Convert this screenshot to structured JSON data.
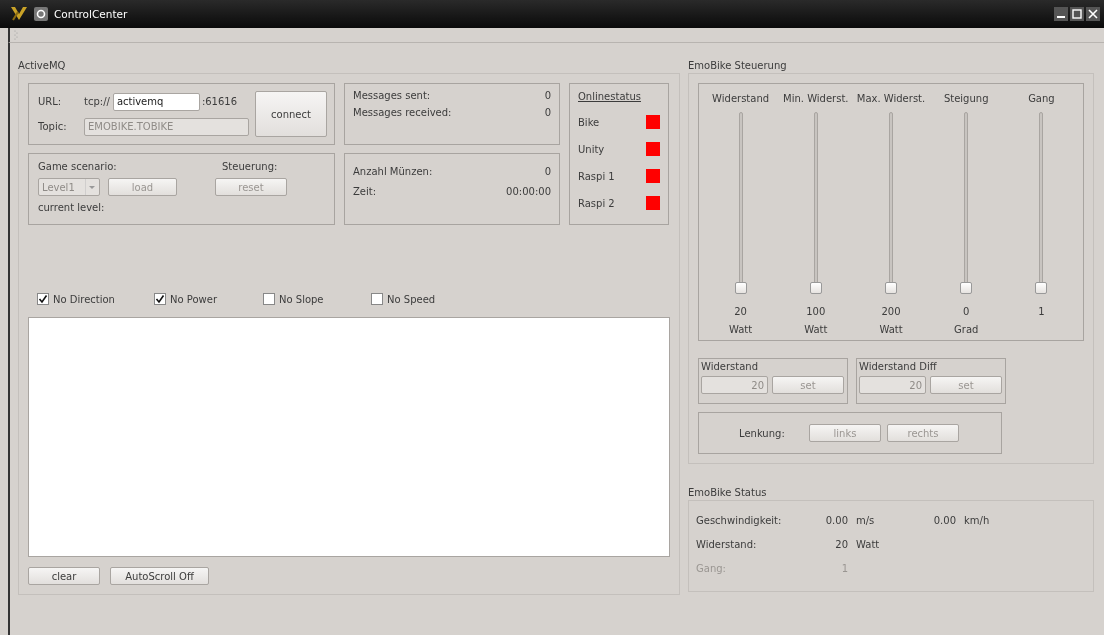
{
  "window": {
    "title": "ControlCenter"
  },
  "activemq": {
    "title": "ActiveMQ",
    "url_label": "URL:",
    "url_prefix": "tcp://",
    "url_value": "activemq",
    "url_port": ":61616",
    "topic_label": "Topic:",
    "topic_value": "EMOBIKE.TOBIKE",
    "connect_button": "connect",
    "messages": [
      {
        "label": "Messages sent:",
        "value": "0"
      },
      {
        "label": "Messages received:",
        "value": "0"
      }
    ],
    "online_title": "Onlinestatus",
    "online": [
      {
        "name": "Bike",
        "color": "#ff0000"
      },
      {
        "name": "Unity",
        "color": "#ff0000"
      },
      {
        "name": "Raspi 1",
        "color": "#ff0000"
      },
      {
        "name": "Raspi 2",
        "color": "#ff0000"
      }
    ],
    "game_label": "Game scenario:",
    "level_select": {
      "value": "Level1",
      "disabled": true
    },
    "load_button": {
      "label": "load",
      "disabled": true
    },
    "steuerung_label": "Steuerung:",
    "reset_button": {
      "label": "reset",
      "disabled": true
    },
    "current_level_label": "current level:",
    "game_stats": [
      {
        "label": "Anzahl Münzen:",
        "value": "0"
      },
      {
        "label": "Zeit:",
        "value": "00:00:00"
      }
    ],
    "filters": [
      {
        "label": "No Direction",
        "checked": true
      },
      {
        "label": "No Power",
        "checked": true
      },
      {
        "label": "No Slope",
        "checked": false
      },
      {
        "label": "No Speed",
        "checked": false
      }
    ],
    "buttons": [
      {
        "label": "clear"
      },
      {
        "label": "AutoScroll Off"
      }
    ]
  },
  "steuerung": {
    "title": "EmoBike Steuerung",
    "sliders": [
      {
        "label": "Widerstand",
        "level": 0,
        "value": "20",
        "unit": "Watt"
      },
      {
        "label": "Min. Widerst.",
        "level": 0,
        "value": "100",
        "unit": "Watt"
      },
      {
        "label": "Max. Widerst.",
        "level": 0,
        "value": "200",
        "unit": "Watt"
      },
      {
        "label": "Steigung",
        "level": 0,
        "value": "0",
        "unit": "Grad"
      },
      {
        "label": "Gang",
        "level": 0,
        "value": "1"
      }
    ],
    "setters": [
      {
        "title": "Widerstand",
        "value": "20",
        "button": {
          "label": "set",
          "disabled": true
        }
      },
      {
        "title": "Widerstand Diff",
        "value": "20",
        "button": {
          "label": "set",
          "disabled": true
        }
      }
    ],
    "lenkung": {
      "label": "Lenkung:",
      "buttons": [
        {
          "label": "links",
          "disabled": true
        },
        {
          "label": "rechts",
          "disabled": true
        }
      ]
    }
  },
  "status": {
    "title": "EmoBike Status",
    "rows": [
      {
        "label": "Geschwindigkeit:",
        "value": "0.00",
        "unit": "m/s",
        "value_2": "0.00",
        "unit_2": "km/h",
        "disabled": false
      },
      {
        "label": "Widerstand:",
        "value": "20",
        "unit": "Watt",
        "disabled": false
      },
      {
        "label": "Gang:",
        "value": "1",
        "disabled": true
      }
    ]
  }
}
